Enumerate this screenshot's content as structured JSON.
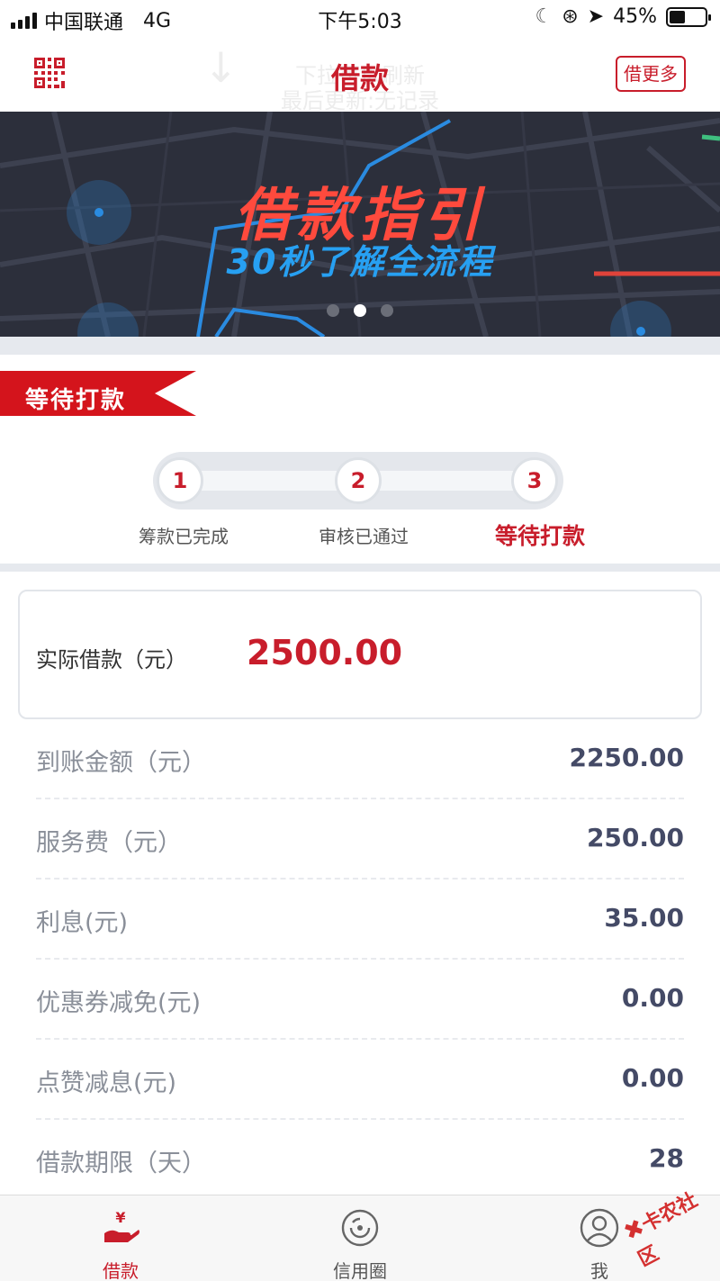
{
  "status_bar": {
    "carrier": "中国联通",
    "network": "4G",
    "time": "下午5:03",
    "battery_percent": "45%",
    "battery_level": 0.45
  },
  "navbar": {
    "title": "借款",
    "more_button": "借更多",
    "ghost_line1": "下拉可以刷新",
    "ghost_line2": "最后更新:无记录"
  },
  "banner": {
    "title": "借款指引",
    "subtitle": "30秒了解全流程",
    "slide_count": 3,
    "active_slide": 2
  },
  "status_ribbon": "等待打款",
  "steps": [
    {
      "number": "1",
      "label": "筹款已完成",
      "active": false
    },
    {
      "number": "2",
      "label": "审核已通过",
      "active": false
    },
    {
      "number": "3",
      "label": "等待打款",
      "active": true
    }
  ],
  "actual_borrow": {
    "label": "实际借款（元）",
    "value": "2500.00"
  },
  "details": [
    {
      "label": "到账金额（元）",
      "value": "2250.00"
    },
    {
      "label": "服务费（元）",
      "value": "250.00"
    },
    {
      "label": "利息(元)",
      "value": "35.00"
    },
    {
      "label": "优惠券减免(元)",
      "value": "0.00"
    },
    {
      "label": "点赞减息(元)",
      "value": "0.00"
    },
    {
      "label": "借款期限（天）",
      "value": "28"
    }
  ],
  "tabs": [
    {
      "label": "借款",
      "icon": "hand-yuan-icon",
      "active": true
    },
    {
      "label": "信用圈",
      "icon": "credit-circle-icon",
      "active": false
    },
    {
      "label": "我",
      "icon": "user-icon",
      "active": false
    }
  ],
  "watermark": "卡农社区",
  "colors": {
    "accent": "#c81d2b",
    "banner_bg": "#2c2f3b",
    "banner_title": "#ff4a3d",
    "banner_subtitle": "#27a0f2"
  }
}
